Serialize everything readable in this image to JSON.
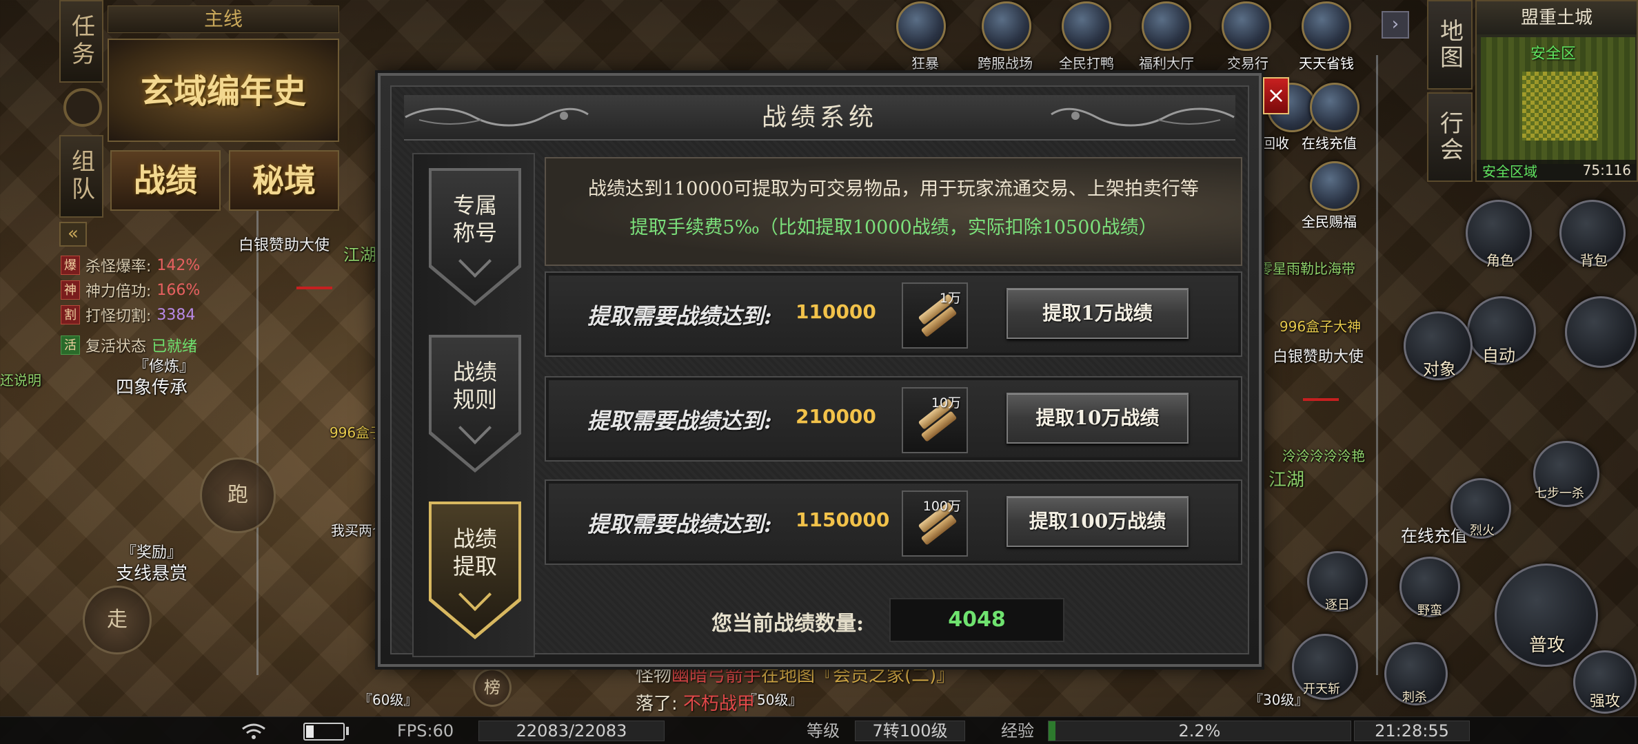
{
  "quest_panel": {
    "tab_task": "任务",
    "tab_team": "组队",
    "main_line": "主线",
    "chronicle_title": "玄域编年史",
    "tab_record": "战绩",
    "tab_secret": "秘境"
  },
  "buffs": [
    {
      "tag": "爆",
      "label": "杀怪爆率:",
      "value": "142%"
    },
    {
      "tag": "神",
      "label": "神力倍功:",
      "value": "166%"
    },
    {
      "tag": "割",
      "label": "打怪切割:",
      "value": "3384"
    },
    {
      "tag": "活",
      "label": "复活状态",
      "value": "已就绪"
    }
  ],
  "left_npcs": {
    "n1": "『修炼』",
    "n1_sub": "四象传承",
    "n2": "『奖励』",
    "n2_sub": "支线悬赏",
    "n3": "还说明",
    "n4": "我买两个"
  },
  "controls": {
    "run": "跑",
    "walk": "走"
  },
  "top_icons": [
    {
      "label": "狂暴"
    },
    {
      "label": "跨服战场"
    },
    {
      "label": "全民打鸭"
    },
    {
      "label": "福利大厅"
    },
    {
      "label": "交易行"
    },
    {
      "label": "天天省钱"
    }
  ],
  "right_icons": {
    "online_recharge": "在线充值",
    "all_people_gift": "全民赐福",
    "recycle": "回收"
  },
  "map": {
    "title": "盟重土城",
    "safe_top": "安全区",
    "safe_bottom": "安全区域",
    "coords": "75:116",
    "tab_map": "地图",
    "tab_guild": "行会"
  },
  "skills": {
    "role": "角色",
    "bag": "背包",
    "auto": "自动",
    "target": "对象",
    "basic_attack": "普攻",
    "strong_attack": "强攻",
    "savage": "野蛮",
    "leap": "逐日",
    "sky_strike": "开天斩",
    "kill": "刺杀",
    "fire": "烈火",
    "seven_step": "七步一杀"
  },
  "world_labels": {
    "gold_sponsor": "白银赞助大使",
    "zero_star": "零星雨勒比海带",
    "god996": "996盒子大神",
    "cold": "泠泠泠泠泠艳",
    "jianghu": "江湖",
    "online_recharge_npc": "在线充值",
    "level60": "『60级』",
    "level30": "『30级』",
    "level50": "『50级』"
  },
  "chat": {
    "line1_prefix": "怪物",
    "line1_monster": "幽暗弓箭手",
    "line1_suffix": "在地图『会员之家(二)』",
    "line2_prefix": "落了:",
    "line2_item": "不朽战甲"
  },
  "modal": {
    "title": "战绩系统",
    "close": "×",
    "tabs": [
      {
        "line1": "专属",
        "line2": "称号",
        "active": false
      },
      {
        "line1": "战绩",
        "line2": "规则",
        "active": false
      },
      {
        "line1": "战绩",
        "line2": "提取",
        "active": true
      }
    ],
    "info_line1": "战绩达到110000可提取为可交易物品，用于玩家流通交易、上架拍卖行等",
    "info_line2": "提取手续费5‰（比如提取10000战绩，实际扣除10500战绩）",
    "rows": [
      {
        "label": "提取需要战绩达到:",
        "value": "110000",
        "item_qty": "1万",
        "button": "提取1万战绩"
      },
      {
        "label": "提取需要战绩达到:",
        "value": "210000",
        "item_qty": "10万",
        "button": "提取10万战绩"
      },
      {
        "label": "提取需要战绩达到:",
        "value": "1150000",
        "item_qty": "100万",
        "button": "提取100万战绩"
      }
    ],
    "current_label": "您当前战绩数量:",
    "current_value": "4048"
  },
  "status_bar": {
    "fps": "FPS:60",
    "hp": "22083/22083",
    "level_label": "等级",
    "level_value": "7转100级",
    "exp_label": "经验",
    "exp_value": "2.2%",
    "exp_fraction": 0.022,
    "time": "21:28:55",
    "battery_fraction": 0.2
  },
  "rank_icon": "榜"
}
